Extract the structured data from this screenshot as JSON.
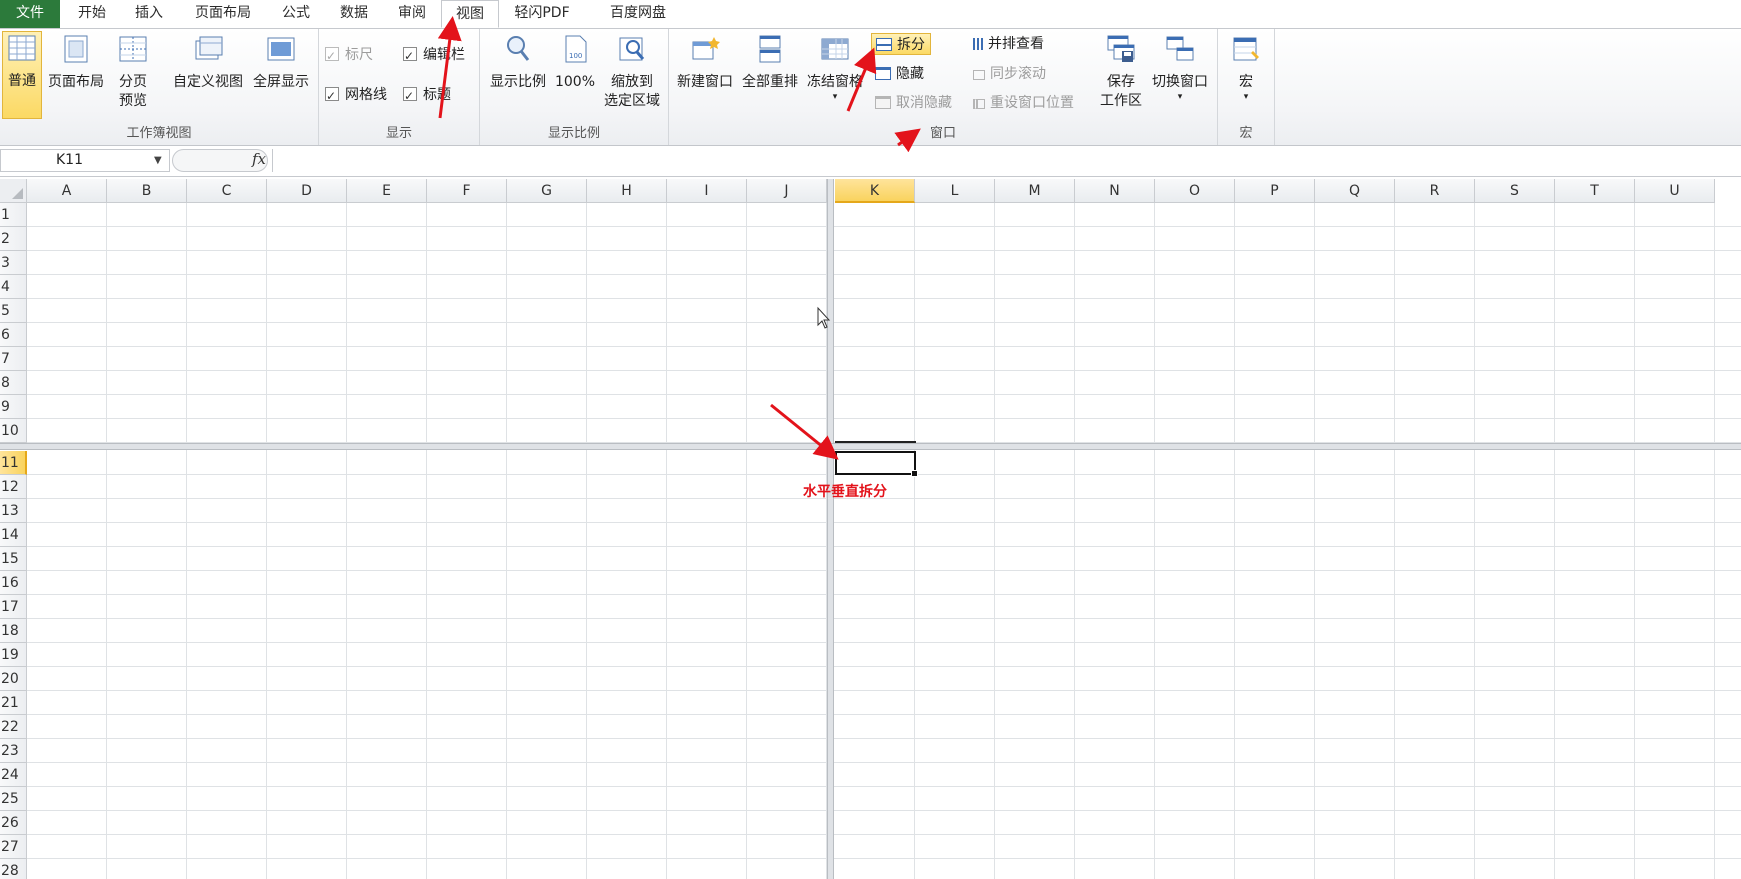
{
  "tabs": [
    {
      "label": "文件"
    },
    {
      "label": "开始"
    },
    {
      "label": "插入"
    },
    {
      "label": "页面布局"
    },
    {
      "label": "公式"
    },
    {
      "label": "数据"
    },
    {
      "label": "审阅"
    },
    {
      "label": "视图"
    },
    {
      "label": "轻闪PDF"
    },
    {
      "label": "百度网盘"
    }
  ],
  "ribbon": {
    "workbook_views": {
      "group_label": "工作簿视图",
      "normal": "普通",
      "page_layout": "页面布局",
      "page_break_line1": "分页",
      "page_break_line2": "预览",
      "custom_views": "自定义视图",
      "full_screen": "全屏显示"
    },
    "show": {
      "group_label": "显示",
      "ruler": "标尺",
      "formula_bar": "编辑栏",
      "gridlines": "网格线",
      "headings": "标题"
    },
    "zoom": {
      "group_label": "显示比例",
      "zoom": "显示比例",
      "hundred": "100%",
      "zoom_sel_line1": "缩放到",
      "zoom_sel_line2": "选定区域"
    },
    "window": {
      "group_label": "窗口",
      "new_window": "新建窗口",
      "arrange_all": "全部重排",
      "freeze_panes": "冻结窗格",
      "split": "拆分",
      "hide": "隐藏",
      "unhide": "取消隐藏",
      "side_by_side": "并排查看",
      "sync_scroll": "同步滚动",
      "reset_position": "重设窗口位置",
      "save_ws_line1": "保存",
      "save_ws_line2": "工作区",
      "switch_windows": "切换窗口"
    },
    "macros": {
      "group_label": "宏",
      "macros": "宏"
    }
  },
  "formula_bar": {
    "name_box": "K11",
    "fx_label": "fx",
    "formula": ""
  },
  "grid": {
    "left_columns": [
      "A",
      "B",
      "C",
      "D",
      "E",
      "F",
      "G",
      "H",
      "I",
      "J"
    ],
    "right_columns": [
      "K",
      "L",
      "M",
      "N",
      "O",
      "P",
      "Q",
      "R",
      "S",
      "T",
      "U"
    ],
    "selected_column": "K",
    "top_rows": [
      "1",
      "2",
      "3",
      "4",
      "5",
      "6",
      "7",
      "8",
      "9",
      "10"
    ],
    "bottom_rows": [
      "11",
      "12",
      "13",
      "14",
      "15",
      "16",
      "17",
      "18",
      "19",
      "20",
      "21",
      "22",
      "23",
      "24",
      "25",
      "26",
      "27",
      "28"
    ],
    "selected_row": "11"
  },
  "annotation": {
    "text": "水平垂直拆分",
    "color": "#e3131b"
  },
  "colors": {
    "file_tab": "#2c7a3b",
    "selected_header": "#f9d35e",
    "highlight_button": "#fbd964"
  }
}
